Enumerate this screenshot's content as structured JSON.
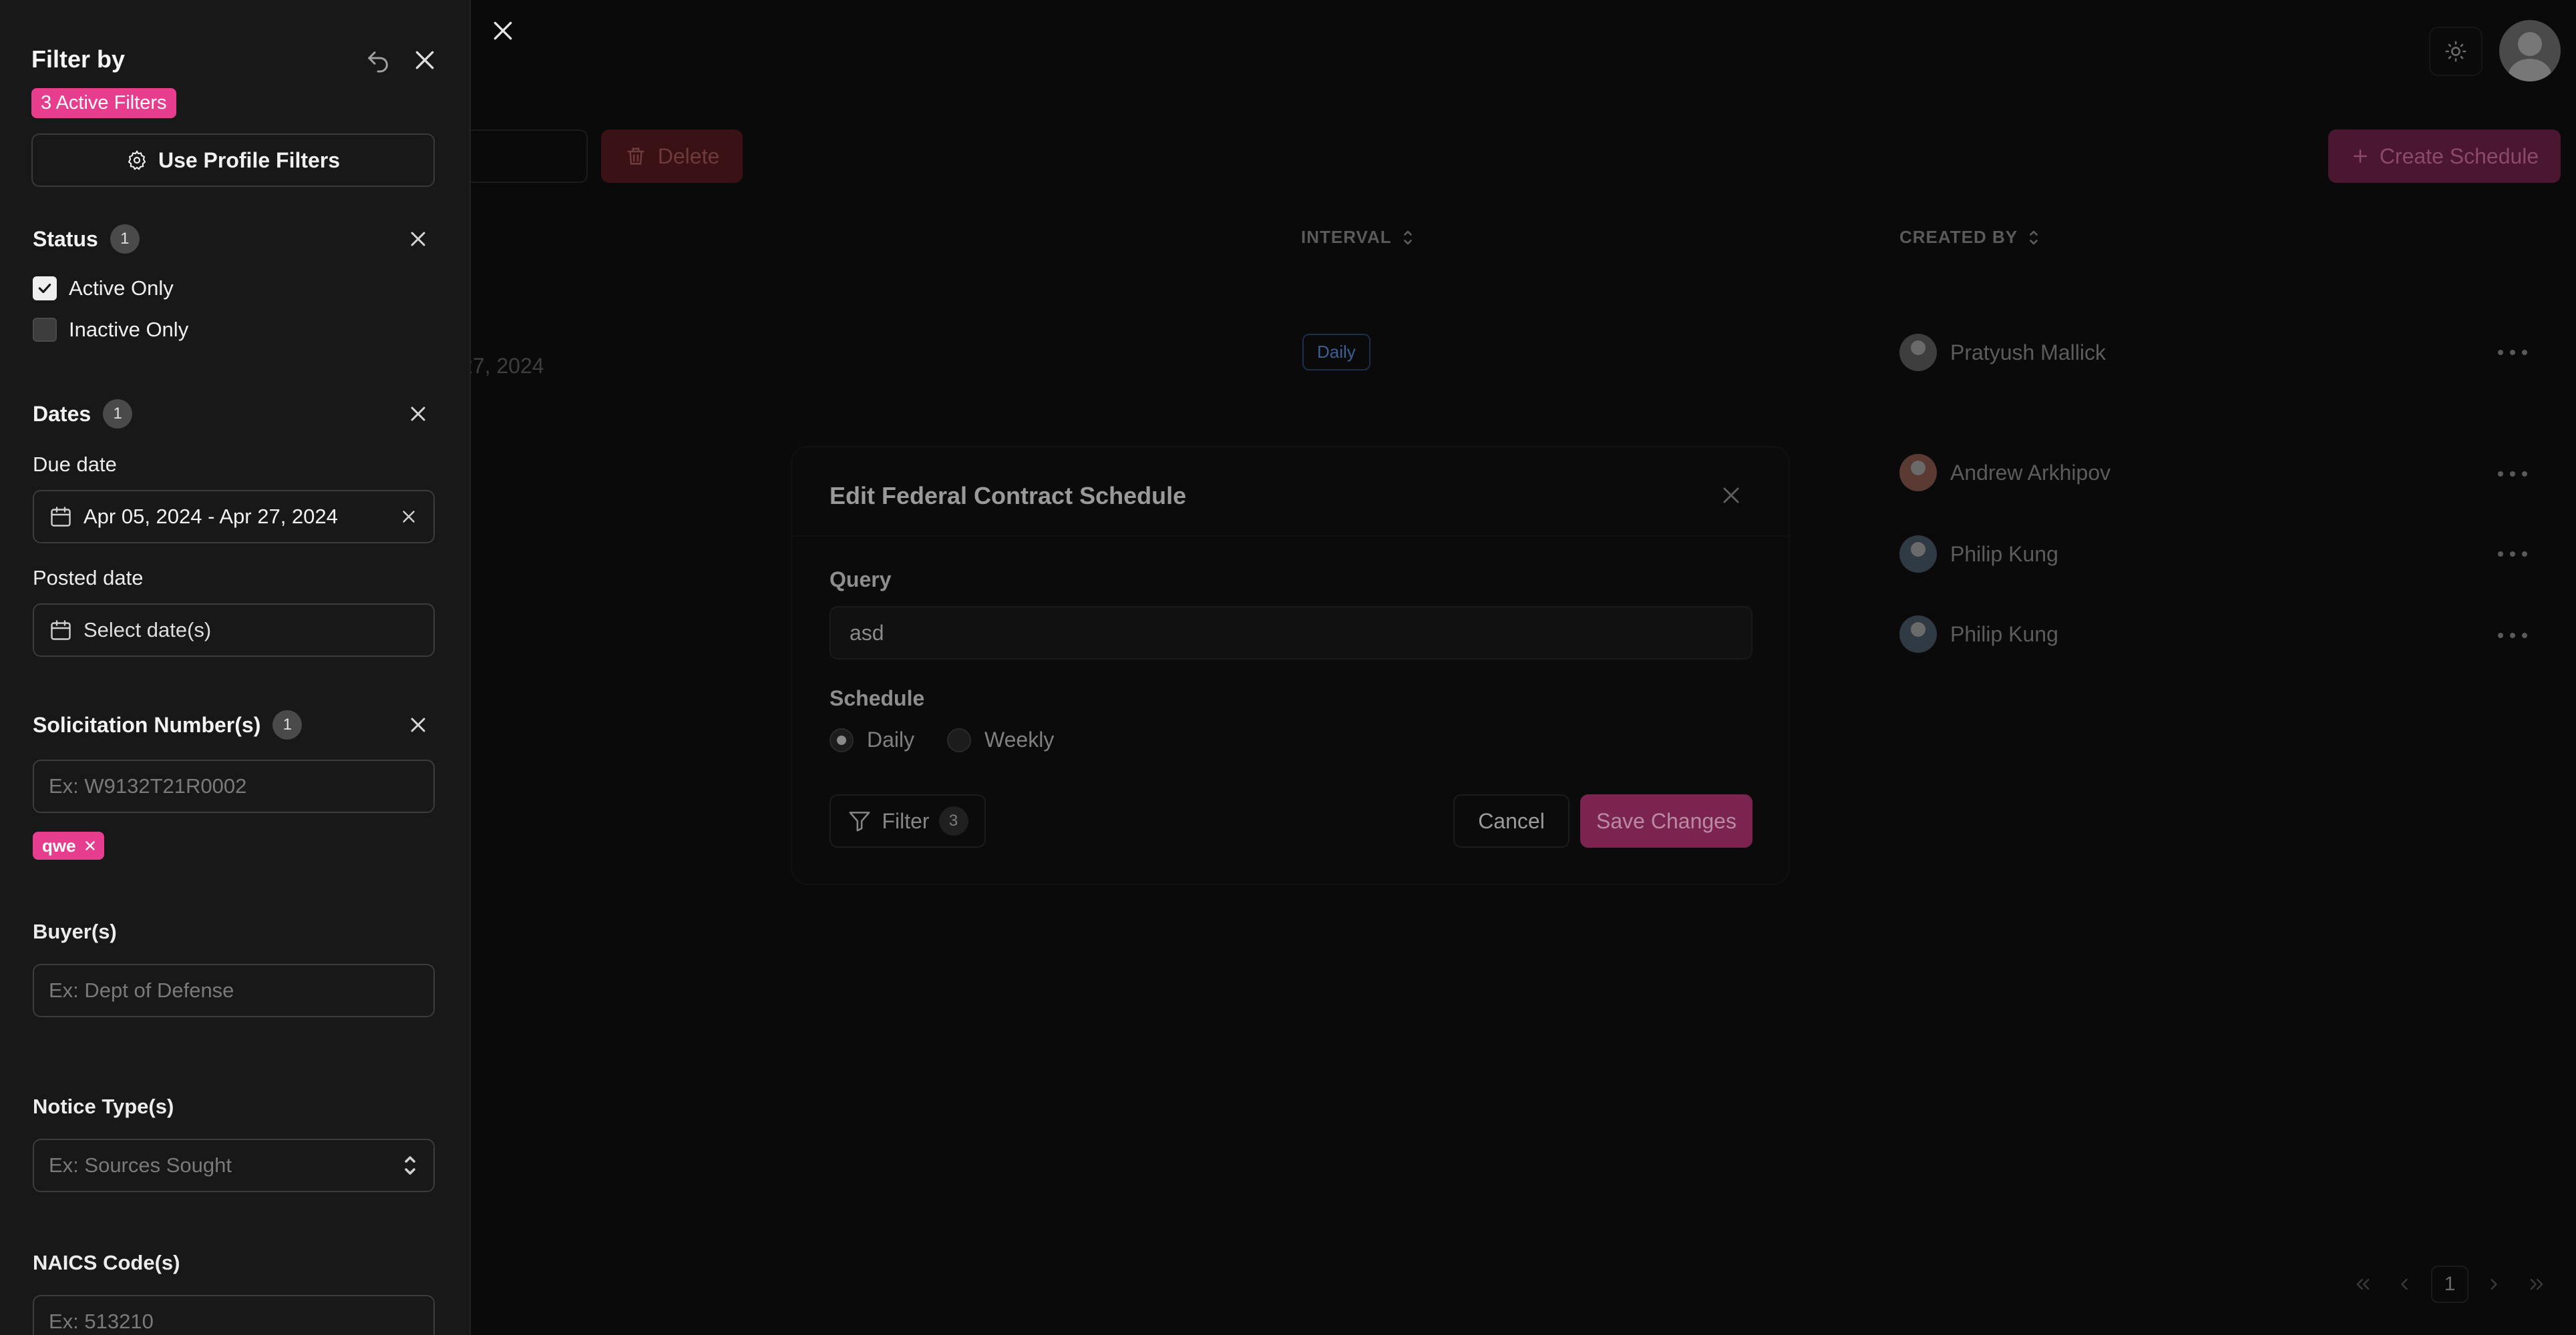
{
  "colors": {
    "accent": "#e73d8f",
    "panel_bg": "#181818",
    "page_bg": "#070707"
  },
  "filter_panel": {
    "title": "Filter by",
    "active_filters_badge": "3 Active Filters",
    "profile_button_label": "Use Profile Filters",
    "status": {
      "title": "Status",
      "count": "1",
      "options": [
        {
          "label": "Active Only",
          "checked": true
        },
        {
          "label": "Inactive Only",
          "checked": false
        }
      ]
    },
    "dates": {
      "title": "Dates",
      "count": "1",
      "due_date_label": "Due date",
      "due_date_value": "Apr 05, 2024 - Apr 27, 2024",
      "posted_date_label": "Posted date",
      "posted_date_placeholder": "Select date(s)"
    },
    "solicitation": {
      "title": "Solicitation Number(s)",
      "count": "1",
      "placeholder": "Ex: W9132T21R0002",
      "chips": [
        "qwe"
      ]
    },
    "buyers": {
      "title": "Buyer(s)",
      "placeholder": "Ex: Dept of Defense"
    },
    "notice_types": {
      "title": "Notice Type(s)",
      "placeholder": "Ex: Sources Sought"
    },
    "naics": {
      "title": "NAICS Code(s)",
      "placeholder": "Ex: 513210"
    }
  },
  "background": {
    "toolbar": {
      "delete_label": "Delete",
      "create_label": "Create Schedule"
    },
    "columns": {
      "interval": "INTERVAL",
      "created_by": "CREATED BY"
    },
    "date_fragment": "27, 2024",
    "interval_badge": "Daily",
    "rows": [
      {
        "created_by": "Pratyush Mallick"
      },
      {
        "created_by": "Andrew Arkhipov"
      },
      {
        "created_by": "Philip Kung"
      },
      {
        "created_by": "Philip Kung"
      }
    ],
    "pagination": {
      "current_page": "1"
    }
  },
  "modal": {
    "title": "Edit Federal Contract Schedule",
    "query_label": "Query",
    "query_value": "asd",
    "schedule_label": "Schedule",
    "schedule_options": [
      {
        "label": "Daily",
        "selected": true
      },
      {
        "label": "Weekly",
        "selected": false
      }
    ],
    "filter_label": "Filter",
    "filter_count": "3",
    "cancel_label": "Cancel",
    "save_label": "Save Changes"
  }
}
